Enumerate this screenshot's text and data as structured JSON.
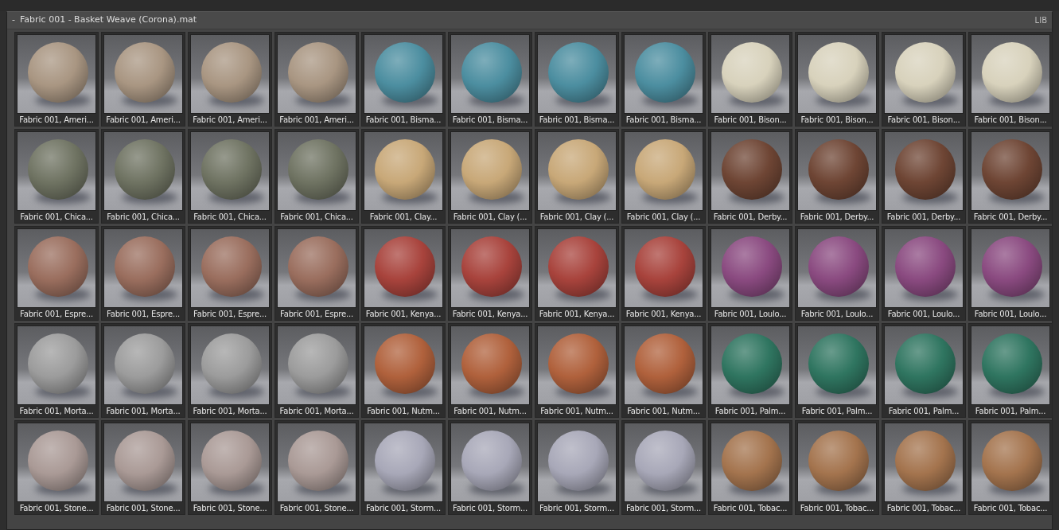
{
  "panel": {
    "collapse_glyph": "-",
    "title": "Fabric 001 - Basket Weave (Corona).mat",
    "badge": "LIB"
  },
  "materials": [
    {
      "label": "Fabric 001, Ameri...",
      "color": "#a99682"
    },
    {
      "label": "Fabric 001, Ameri...",
      "color": "#a99682"
    },
    {
      "label": "Fabric 001, Ameri...",
      "color": "#a99682"
    },
    {
      "label": "Fabric 001, Ameri...",
      "color": "#a99682"
    },
    {
      "label": "Fabric 001, Bisma...",
      "color": "#4c8ea0"
    },
    {
      "label": "Fabric 001, Bisma...",
      "color": "#4c8ea0"
    },
    {
      "label": "Fabric 001, Bisma...",
      "color": "#4c8ea0"
    },
    {
      "label": "Fabric 001, Bisma...",
      "color": "#4c8ea0"
    },
    {
      "label": "Fabric 001, Bison...",
      "color": "#d8d2bc"
    },
    {
      "label": "Fabric 001, Bison...",
      "color": "#d8d2bc"
    },
    {
      "label": "Fabric 001, Bison...",
      "color": "#d8d2bc"
    },
    {
      "label": "Fabric 001, Bison...",
      "color": "#d8d2bc"
    },
    {
      "label": "Fabric 001, Chica...",
      "color": "#6f7362"
    },
    {
      "label": "Fabric 001, Chica...",
      "color": "#6f7362"
    },
    {
      "label": "Fabric 001, Chica...",
      "color": "#6f7362"
    },
    {
      "label": "Fabric 001, Chica...",
      "color": "#6f7362"
    },
    {
      "label": "Fabric 001, Clay...",
      "color": "#c8a878"
    },
    {
      "label": "Fabric 001, Clay (...",
      "color": "#c8a878"
    },
    {
      "label": "Fabric 001, Clay (...",
      "color": "#c8a878"
    },
    {
      "label": "Fabric 001, Clay (...",
      "color": "#c8a878"
    },
    {
      "label": "Fabric 001, Derby...",
      "color": "#6e4534"
    },
    {
      "label": "Fabric 001, Derby...",
      "color": "#6e4534"
    },
    {
      "label": "Fabric 001, Derby...",
      "color": "#6e4534"
    },
    {
      "label": "Fabric 001, Derby...",
      "color": "#6e4534"
    },
    {
      "label": "Fabric 001, Espre...",
      "color": "#9a6e5e"
    },
    {
      "label": "Fabric 001, Espre...",
      "color": "#9a6e5e"
    },
    {
      "label": "Fabric 001, Espre...",
      "color": "#9a6e5e"
    },
    {
      "label": "Fabric 001, Espre...",
      "color": "#9a6e5e"
    },
    {
      "label": "Fabric 001, Kenya...",
      "color": "#a8433c"
    },
    {
      "label": "Fabric 001, Kenya...",
      "color": "#a8433c"
    },
    {
      "label": "Fabric 001, Kenya...",
      "color": "#a8433c"
    },
    {
      "label": "Fabric 001, Kenya...",
      "color": "#a8433c"
    },
    {
      "label": "Fabric 001, Loulo...",
      "color": "#8a4a80"
    },
    {
      "label": "Fabric 001, Loulo...",
      "color": "#8a4a80"
    },
    {
      "label": "Fabric 001, Loulo...",
      "color": "#8a4a80"
    },
    {
      "label": "Fabric 001, Loulo...",
      "color": "#8a4a80"
    },
    {
      "label": "Fabric 001, Morta...",
      "color": "#9c9c9c"
    },
    {
      "label": "Fabric 001, Morta...",
      "color": "#9c9c9c"
    },
    {
      "label": "Fabric 001, Morta...",
      "color": "#9c9c9c"
    },
    {
      "label": "Fabric 001, Morta...",
      "color": "#9c9c9c"
    },
    {
      "label": "Fabric 001, Nutm...",
      "color": "#b0613c"
    },
    {
      "label": "Fabric 001, Nutm...",
      "color": "#b0613c"
    },
    {
      "label": "Fabric 001, Nutm...",
      "color": "#b0613c"
    },
    {
      "label": "Fabric 001, Nutm...",
      "color": "#b0613c"
    },
    {
      "label": "Fabric 001, Palm...",
      "color": "#2f7560"
    },
    {
      "label": "Fabric 001, Palm...",
      "color": "#2f7560"
    },
    {
      "label": "Fabric 001, Palm...",
      "color": "#2f7560"
    },
    {
      "label": "Fabric 001, Palm...",
      "color": "#2f7560"
    },
    {
      "label": "Fabric 001, Stone...",
      "color": "#aa9a96"
    },
    {
      "label": "Fabric 001, Stone...",
      "color": "#aa9a96"
    },
    {
      "label": "Fabric 001, Stone...",
      "color": "#aa9a96"
    },
    {
      "label": "Fabric 001, Stone...",
      "color": "#aa9a96"
    },
    {
      "label": "Fabric 001, Storm...",
      "color": "#a8a8b8"
    },
    {
      "label": "Fabric 001, Storm...",
      "color": "#a8a8b8"
    },
    {
      "label": "Fabric 001, Storm...",
      "color": "#a8a8b8"
    },
    {
      "label": "Fabric 001, Storm...",
      "color": "#a8a8b8"
    },
    {
      "label": "Fabric 001, Tobac...",
      "color": "#a4744e"
    },
    {
      "label": "Fabric 001, Tobac...",
      "color": "#a4744e"
    },
    {
      "label": "Fabric 001, Tobac...",
      "color": "#a4744e"
    },
    {
      "label": "Fabric 001, Tobac...",
      "color": "#a4744e"
    }
  ]
}
